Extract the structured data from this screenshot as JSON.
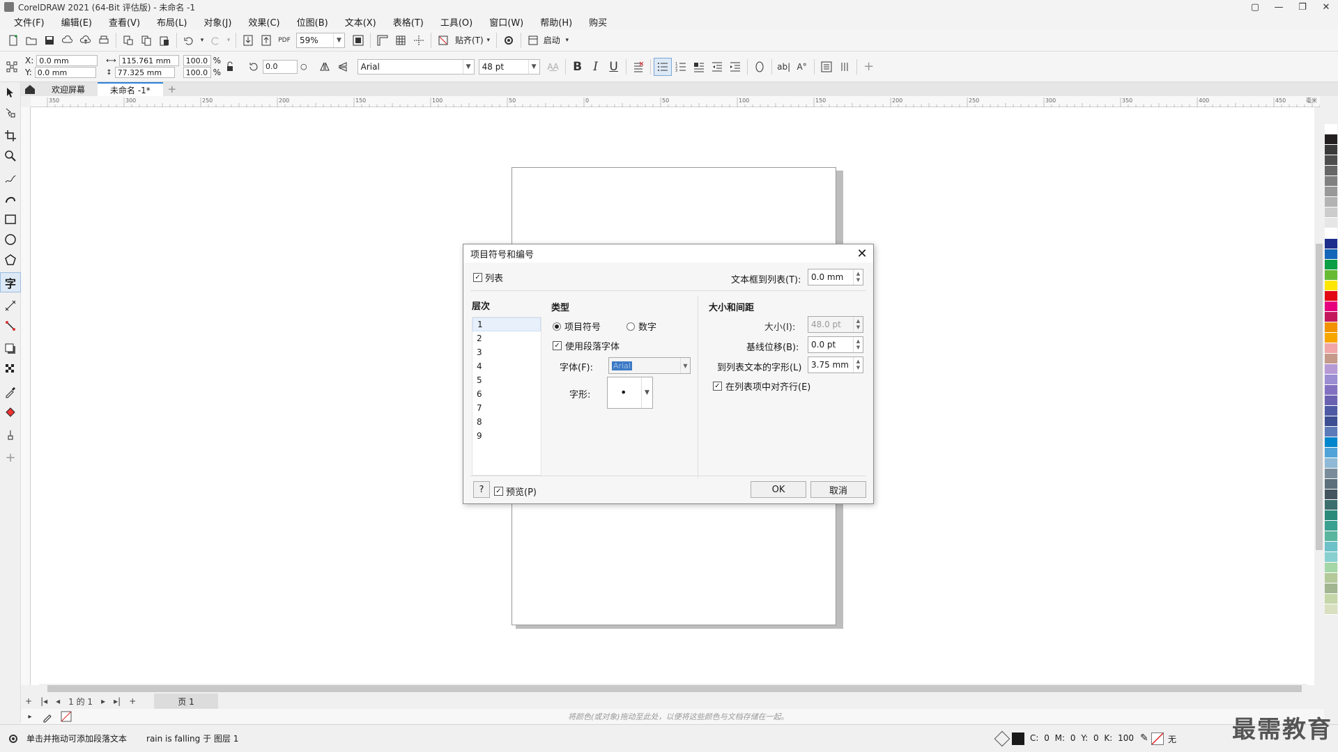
{
  "window": {
    "title": "CorelDRAW 2021 (64-Bit 评估版) - 未命名 -1"
  },
  "menu": [
    "文件(F)",
    "编辑(E)",
    "查看(V)",
    "布局(L)",
    "对象(J)",
    "效果(C)",
    "位图(B)",
    "文本(X)",
    "表格(T)",
    "工具(O)",
    "窗口(W)",
    "帮助(H)",
    "购买"
  ],
  "toolbar": {
    "zoom": "59%",
    "snap_label": "贴齐(T)",
    "launch_label": "启动"
  },
  "props": {
    "x_label": "X:",
    "y_label": "Y:",
    "x": "0.0 mm",
    "y": "0.0 mm",
    "w": "115.761 mm",
    "h": "77.325 mm",
    "sx": "100.0",
    "sy": "100.0",
    "pct": "%",
    "rotation": "0.0",
    "font": "Arial",
    "size": "48 pt"
  },
  "tabs": [
    "欢迎屏幕",
    "未命名 -1*"
  ],
  "ruler_labels": [
    "350",
    "300",
    "250",
    "200",
    "150",
    "100",
    "50",
    "0",
    "50",
    "100",
    "150",
    "200",
    "250",
    "300",
    "350",
    "400",
    "450"
  ],
  "ruler_unit": "毫米",
  "page_nav": {
    "of_text": "1 的 1",
    "page_tab": "页 1"
  },
  "palette_hint": "将颜色(或对象)拖动至此处，以便将这些颜色与文档存储在一起。",
  "status": {
    "hint": "单击并拖动可添加段落文本",
    "layer": "rain is falling 于 图层 1",
    "cmyk": "C: 0 M: 0 Y: 0 K: 100",
    "none": "无"
  },
  "watermark": "最需教育",
  "dialog": {
    "title": "项目符号和编号",
    "list_label": "列表",
    "frame_to_list_label": "文本框到列表(T):",
    "frame_to_list_value": "0.0 mm",
    "level_header": "层次",
    "levels": [
      "1",
      "2",
      "3",
      "4",
      "5",
      "6",
      "7",
      "8",
      "9"
    ],
    "type_header": "类型",
    "bullet_label": "项目符号",
    "number_label": "数字",
    "use_para_font_label": "使用段落字体",
    "font_label": "字体(F):",
    "font_value": "Arial",
    "glyph_label": "字形:",
    "glyph_value": "•",
    "size_header": "大小和间距",
    "size_label": "大小(I):",
    "size_value": "48.0 pt",
    "baseline_label": "基线位移(B):",
    "baseline_value": "0.0 pt",
    "to_list_text_label": "到列表文本的字形(L)",
    "to_list_text_value": "3.75 mm",
    "align_label": "在列表项中对齐行(E)",
    "help_label": "?",
    "preview_label": "预览(P)",
    "ok_label": "OK",
    "cancel_label": "取消"
  },
  "colors": {
    "accent": "#2c7fd6",
    "palette": [
      "#ffffff",
      "#231f20",
      "#3a3a3a",
      "#4d4d4d",
      "#666666",
      "#808080",
      "#999999",
      "#b3b3b3",
      "#cccccc",
      "#e6e6e6",
      "#ffffff",
      "#1d2d8c",
      "#1466b8",
      "#0a9e45",
      "#66bb33",
      "#ffe600",
      "#e30613",
      "#e6007e",
      "#c2185b",
      "#f39200",
      "#f7a600",
      "#f0a6a6",
      "#c59a8a",
      "#b59ad6",
      "#9b8ed1",
      "#8271c0",
      "#6a62b0",
      "#4e5aa4",
      "#3d4e92",
      "#5c79b8",
      "#0086cc",
      "#4fa3d8",
      "#8fb9d6",
      "#7a8c99",
      "#5d6f7a",
      "#445560",
      "#3c6e6e",
      "#2a8a7a",
      "#3aa08f",
      "#5ab59f",
      "#6ec1c8",
      "#89cfd0",
      "#a5d6a7",
      "#b3c99a",
      "#a0b590",
      "#c5d6a8",
      "#d8e0c0"
    ]
  }
}
